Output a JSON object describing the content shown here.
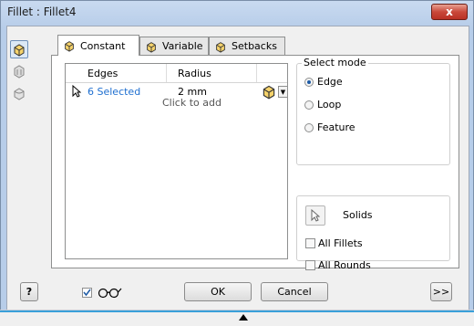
{
  "window": {
    "title": "Fillet : Fillet4",
    "close_label": "x"
  },
  "tabs": [
    {
      "label": "Constant",
      "icon": "cube-icon",
      "active": true
    },
    {
      "label": "Variable",
      "icon": "cube-icon",
      "active": false
    },
    {
      "label": "Setbacks",
      "icon": "cube-icon",
      "active": false
    }
  ],
  "grid": {
    "columns": [
      "Edges",
      "Radius"
    ],
    "rows": [
      {
        "edges": "6 Selected",
        "radius": "2 mm"
      }
    ],
    "add_hint": "Click to add"
  },
  "select_mode": {
    "title": "Select mode",
    "options": [
      "Edge",
      "Loop",
      "Feature"
    ],
    "selected": "Edge"
  },
  "solids": {
    "label": "Solids",
    "all_fillets": "All Fillets",
    "all_rounds": "All Rounds"
  },
  "footer": {
    "help": "?",
    "ok": "OK",
    "cancel": "Cancel",
    "more": ">>",
    "preview_checked": true
  },
  "colors": {
    "accent": "#1f6fd0",
    "close": "#c9483a",
    "selected_text": "#1f6fd0"
  }
}
